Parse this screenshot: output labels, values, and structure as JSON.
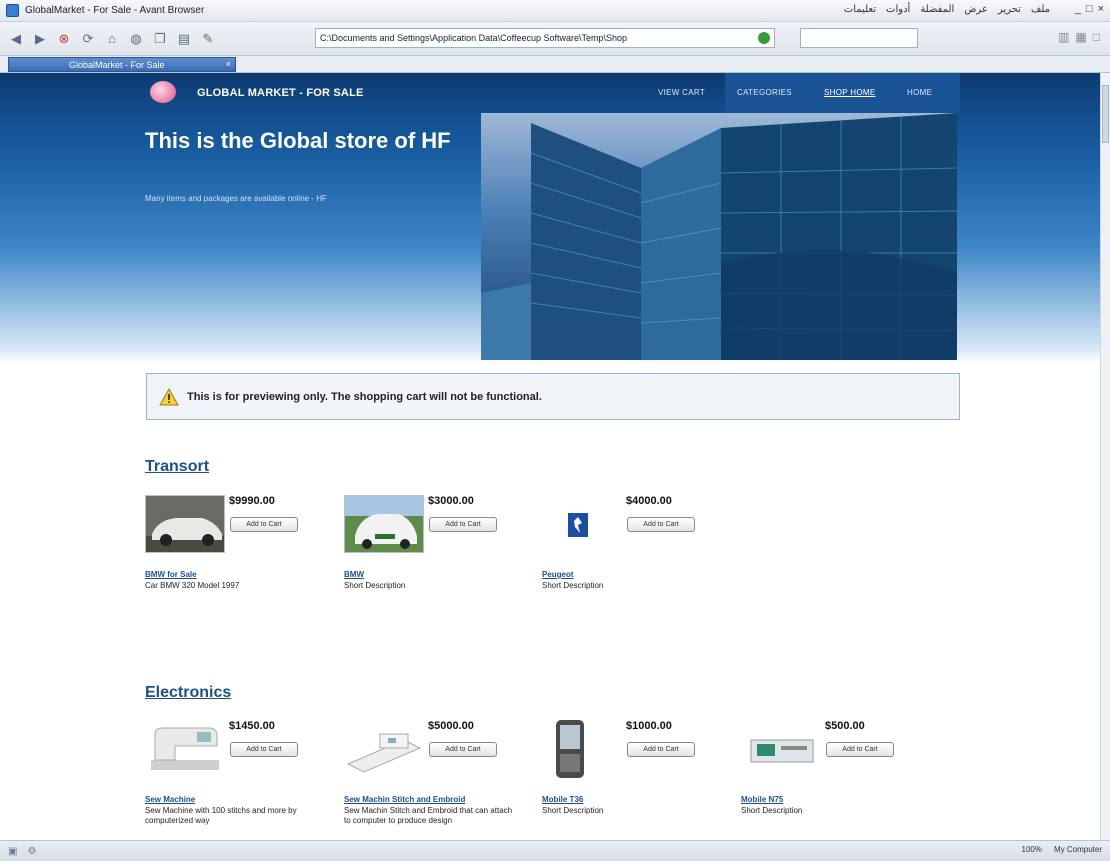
{
  "window": {
    "title": "GlobalMarket - For Sale - Avant Browser",
    "menus": [
      "ملف",
      "تحرير",
      "عرض",
      "المفضلة",
      "أدوات",
      "تعليمات"
    ],
    "controls": [
      "_",
      "□",
      "×"
    ]
  },
  "toolbar": {
    "address": "C:\\Documents and Settings\\Application Data\\Coffeecup Software\\Temp\\Shop",
    "active_tab": "GlobalMarket - For Sale"
  },
  "nav": {
    "brand": "GLOBAL MARKET - FOR SALE",
    "links": [
      "VIEW CART",
      "CATEGORIES",
      "SHOP HOME",
      "HOME"
    ]
  },
  "hero": {
    "title": "This is the Global store of HF",
    "subtitle": "Many items and packages are available online - HF"
  },
  "alert": {
    "text": "This is for previewing only. The shopping cart will not be functional."
  },
  "categories": [
    {
      "title": "Transort",
      "products": [
        {
          "price": "$9990.00",
          "button": "Add to Cart",
          "name": "BMW for Sale",
          "desc": "Car BMW 320 Model 1997"
        },
        {
          "price": "$3000.00",
          "button": "Add to Cart",
          "name": "BMW",
          "desc": "Short Description"
        },
        {
          "price": "$4000.00",
          "button": "Add to Cart",
          "name": "Peugeot",
          "desc": "Short Description"
        }
      ]
    },
    {
      "title": "Electronics",
      "products": [
        {
          "price": "$1450.00",
          "button": "Add to Cart",
          "name": "Sew Machine",
          "desc": "Sew Machine with 100 stitchs and more by computerized way"
        },
        {
          "price": "$5000.00",
          "button": "Add to Cart",
          "name": "Sew Machin Stitch and Embroid",
          "desc": "Sew Machin Stitch and Embroid that can attach to computer to produce design"
        },
        {
          "price": "$1000.00",
          "button": "Add to Cart",
          "name": "Mobile T36",
          "desc": "Short Description"
        },
        {
          "price": "$500.00",
          "button": "Add to Cart",
          "name": "Mobile N75",
          "desc": "Short Description"
        }
      ]
    }
  ],
  "status": {
    "zoom": "100%",
    "zone": "My Computer"
  }
}
